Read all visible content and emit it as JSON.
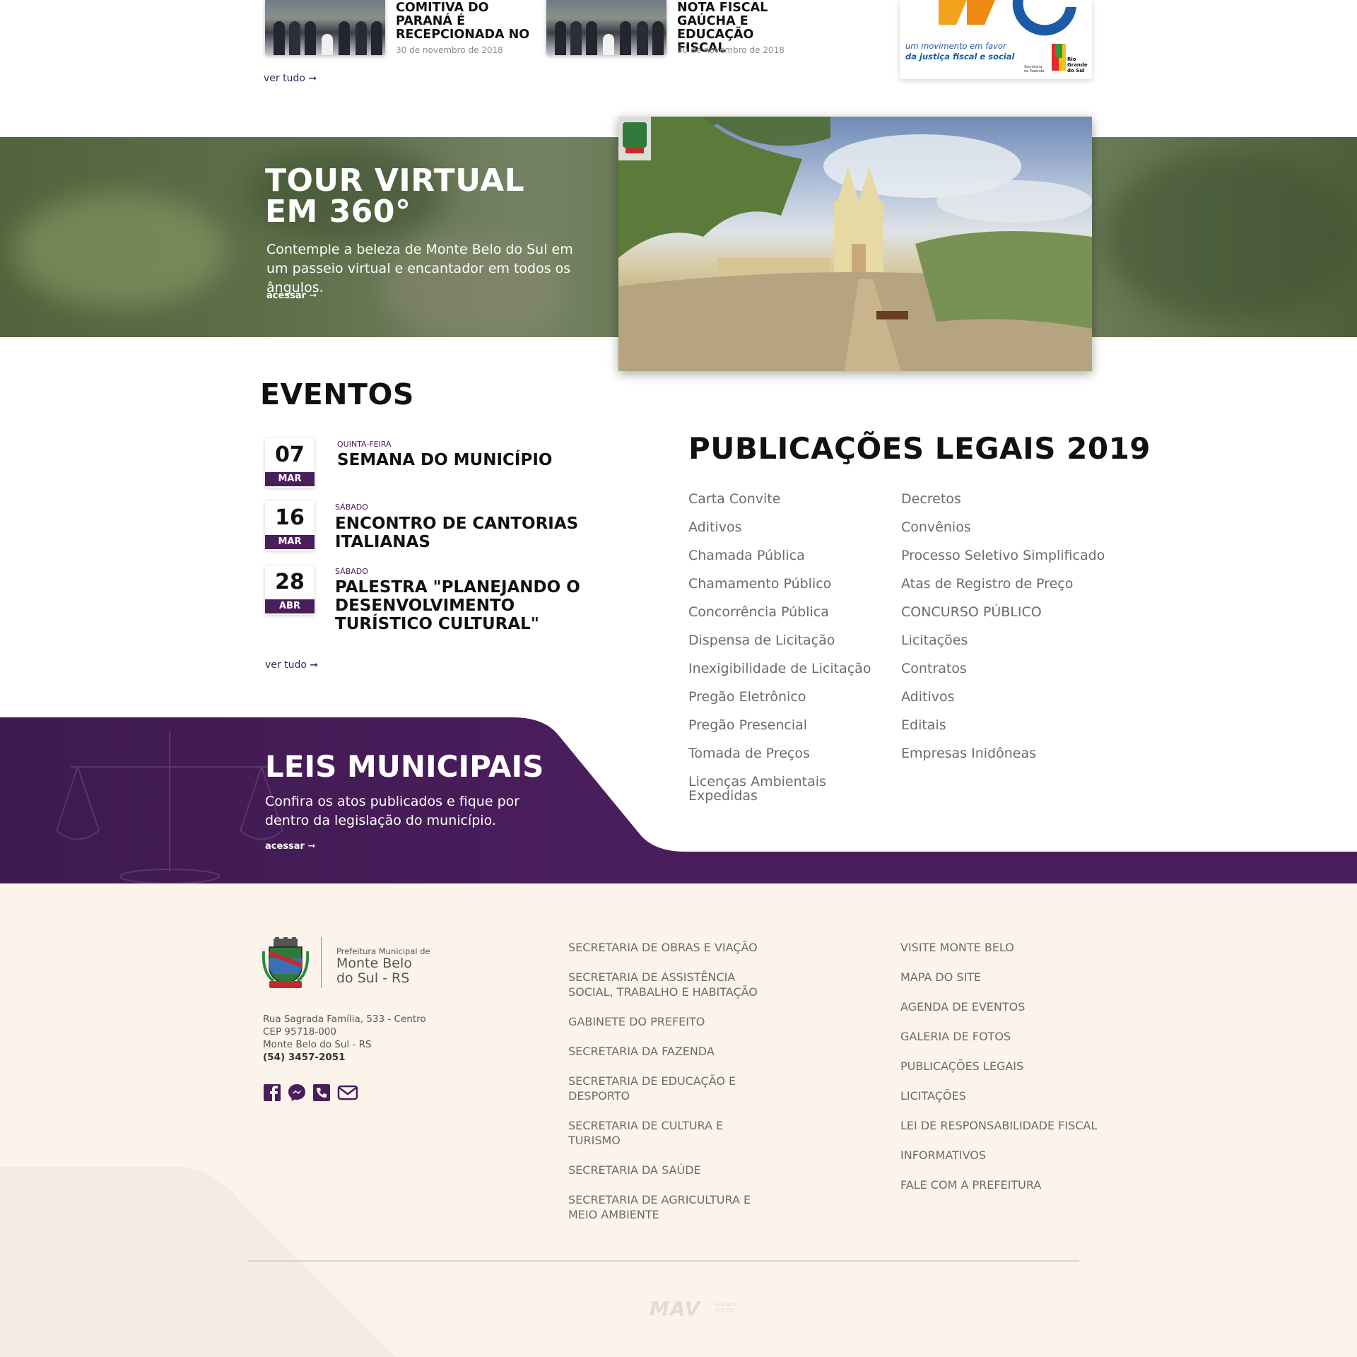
{
  "news": {
    "items": [
      {
        "title": "COMITIVA DO PARANÁ É RECEPCIONADA NO",
        "date": "30 de novembro de 2018"
      },
      {
        "title": "NOTA FISCAL GAÚCHA E EDUCAÇÃO FISCAL",
        "date": "30 de novembro de 2018"
      }
    ],
    "see_all": "ver tudo ➞",
    "banner": {
      "logo_letters": "NG",
      "slogan_1": "um movimento em favor",
      "slogan_2": "da justiça fiscal e social",
      "agency": "Secretaria da Fazenda",
      "state": "Rio Grande do Sul"
    }
  },
  "tour": {
    "title_line1": "TOUR VIRTUAL",
    "title_line2": "EM 360°",
    "description": "Contemple a beleza de Monte Belo do Sul  em um passeio virtual e encantador em todos os ângulos.",
    "link": "acessar ➞"
  },
  "events": {
    "heading": "EVENTOS",
    "items": [
      {
        "day": "07",
        "month": "MAR",
        "weekday": "QUINTA-FEIRA",
        "title": "SEMANA DO MUNICÍPIO"
      },
      {
        "day": "16",
        "month": "MAR",
        "weekday": "SÁBADO",
        "title": "ENCONTRO DE CANTORIAS ITALIANAS"
      },
      {
        "day": "28",
        "month": "ABR",
        "weekday": "SÁBADO",
        "title": "PALESTRA \"PLANEJANDO O DESENVOLVIMENTO TURÍSTICO CULTURAL\""
      }
    ],
    "see_all": "ver tudo ➞"
  },
  "publications": {
    "heading": "PUBLICAÇÕES LEGAIS 2019",
    "col1": [
      "Carta Convite",
      "Aditivos",
      "Chamada Pública",
      "Chamamento Público",
      "Concorrência Pública",
      "Dispensa de Licitação",
      "Inexigibilidade de Licitação",
      "Pregão Eletrônico",
      "Pregão Presencial",
      "Tomada de Preços",
      "Licenças Ambientais Expedidas"
    ],
    "col2": [
      "Decretos",
      "Convênios",
      "Processo Seletivo Simplificado",
      "Atas de Registro de Preço",
      "CONCURSO PÚBLICO",
      "Licitações",
      "Contratos",
      "Aditivos",
      "Editais",
      "Empresas Inidôneas"
    ]
  },
  "laws": {
    "title": "LEIS MUNICIPAIS",
    "description": "Confira os atos publicados e fique por dentro da legislação do município.",
    "link": "acessar ➞"
  },
  "footer": {
    "logo_caption": "Prefeitura Municipal de",
    "logo_name_1": "Monte Belo",
    "logo_name_2": "do Sul - RS",
    "address_1": "Rua Sagrada Família, 533 - Centro",
    "address_2": "CEP 95718-000",
    "address_3": "Monte Belo do Sul - RS",
    "phone": "(54) 3457-2051",
    "secretariats": [
      "SECRETARIA DE OBRAS E VIAÇÃO",
      "SECRETARIA DE ASSISTÊNCIA SOCIAL, TRABALHO E HABITAÇÃO",
      "GABINETE DO PREFEITO",
      "SECRETARIA DA FAZENDA",
      "SECRETARIA DE EDUCAÇÃO E DESPORTO",
      "SECRETARIA DE CULTURA E TURISMO",
      "SECRETARIA DA SAÚDE",
      "SECRETARIA DE AGRICULTURA E MEIO AMBIENTE"
    ],
    "links": [
      "VISITE MONTE BELO",
      "MAPA DO SITE",
      "AGENDA DE EVENTOS",
      "GALERIA DE FOTOS",
      "PUBLICAÇÕES LEGAIS",
      "LICITAÇÕES",
      "LEI DE RESPONSABILIDADE FISCAL",
      "INFORMATIVOS",
      "FALE COM A PREFEITURA"
    ],
    "agency_logo": "MAV",
    "agency_sub": "AGÊNCIA DIGITAL",
    "social_icons": [
      "facebook-icon",
      "messenger-icon",
      "phone-icon",
      "mail-icon"
    ]
  },
  "colors": {
    "brand_purple": "#4a1d5b",
    "footer_bg": "#fcf4ea"
  }
}
